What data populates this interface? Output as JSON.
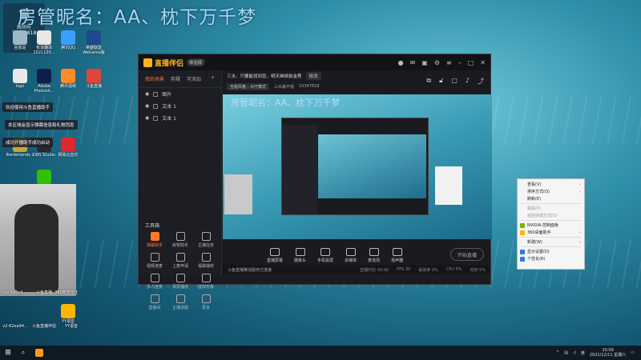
{
  "overlay": {
    "title": "房管昵名：AA、枕下万千梦",
    "room_label": "房间号",
    "room_number": "10347818"
  },
  "desktop_icons": [
    {
      "label": "回收站",
      "color": "#9fb8c8"
    },
    {
      "label": "有道翻译 2021120...",
      "color": "#e8e8e8"
    },
    {
      "label": "腾讯QQ",
      "color": "#3aa0ff"
    },
    {
      "label": "英雄联盟 WeGame版",
      "color": "#1c4a8a"
    },
    {
      "label": "logo",
      "color": "#e8e8e8"
    },
    {
      "label": "Adobe Photosh...",
      "color": "#0f1f4a"
    },
    {
      "label": "腾讯视频",
      "color": "#ff8a2a"
    },
    {
      "label": "斗鱼直播",
      "color": "#e0453a"
    },
    {
      "label": "Borderlands 2",
      "color": "#c8a830"
    },
    {
      "label": "OBS Studio",
      "color": "#2a2a2a"
    },
    {
      "label": "网易云音乐",
      "color": "#e0262e"
    },
    {
      "label": "微信",
      "color": "#2dc100"
    },
    {
      "label": "YY语音",
      "color": "#ffb400"
    }
  ],
  "notices": [
    "欢迎使用斗鱼直播助手",
    "本区域会显示弹幕信息和礼物消息",
    "成功开播助手成功启动"
  ],
  "photo_labels": [
    "v2-1d5c4...",
    "斗鱼直播",
    "360安全卫士",
    "v2-62ea94...",
    "斗鱼直播伴侣",
    "YY语音"
  ],
  "app": {
    "name": "直播伴侣",
    "version": "体验版",
    "sidebar_tabs": [
      "我的场景",
      "剪辑",
      "可添加"
    ],
    "scenes": [
      "图片",
      "文本 1",
      "文本 1"
    ],
    "tools_header": "工具箱",
    "tools": [
      "弹幕助手",
      "房管助手",
      "主播任务",
      "视频连麦",
      "上麦申请",
      "福袋抽奖",
      "多人连麦",
      "录屏播放",
      "虚拟形象",
      "直播间",
      "主播话题",
      "更多"
    ],
    "room_title": "三水、只要能找到您，明天继续拍金秀",
    "title_chip": "修改",
    "category": "全能风格 - 大厅模式",
    "anchor": "三水最不错",
    "room_id": "10347818",
    "bottom_tools": [
      "直播屏幕",
      "摄像头",
      "手机投屏",
      "多媒体",
      "麦克风",
      "扬声器"
    ],
    "start_button": "开始直播",
    "status_left": "斗鱼直播推流服务已连接",
    "status_items": [
      "直播时长 00:00",
      "FPS 30",
      "丢帧率 0%",
      "CPU 5%",
      "内存 5%"
    ],
    "preview_title": "房管昵名：AA、枕下万千梦"
  },
  "context_menu": [
    {
      "label": "查看(V)",
      "arrow": true,
      "disabled": false,
      "icon": ""
    },
    {
      "label": "排序方式(O)",
      "arrow": true,
      "disabled": false,
      "icon": ""
    },
    {
      "label": "刷新(E)",
      "arrow": false,
      "disabled": false,
      "icon": ""
    },
    {
      "sep": true
    },
    {
      "label": "粘贴(P)",
      "arrow": false,
      "disabled": true,
      "icon": ""
    },
    {
      "label": "粘贴快捷方式(S)",
      "arrow": false,
      "disabled": true,
      "icon": ""
    },
    {
      "sep": true
    },
    {
      "label": "NVIDIA 控制面板",
      "arrow": false,
      "disabled": false,
      "icon": "#76b900"
    },
    {
      "label": "360桌面助手",
      "arrow": true,
      "disabled": false,
      "icon": "#ffb400"
    },
    {
      "sep": true
    },
    {
      "label": "新建(W)",
      "arrow": true,
      "disabled": false,
      "icon": ""
    },
    {
      "sep": true
    },
    {
      "label": "显示设置(D)",
      "arrow": false,
      "disabled": false,
      "icon": "#2a7de1"
    },
    {
      "label": "个性化(R)",
      "arrow": false,
      "disabled": false,
      "icon": "#2a7de1"
    }
  ],
  "taskbar": {
    "time": "20:09",
    "date": "2021/12/11 星期六",
    "tray_text": "英"
  },
  "colors": {
    "accent": "#ff7a2a",
    "brand": "#ffb31a"
  }
}
